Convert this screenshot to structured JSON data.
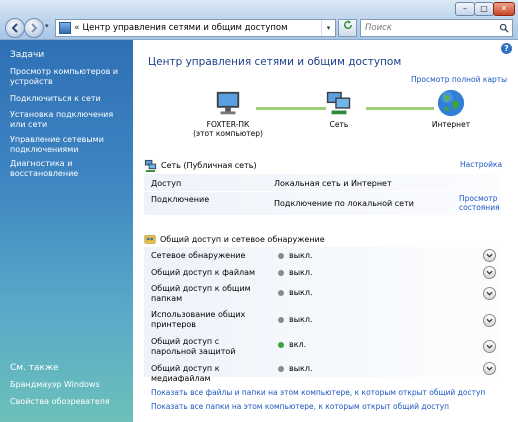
{
  "window": {
    "address_path": "Центр управления сетями и общим доступом",
    "address_prefix": "«",
    "search_placeholder": "Поиск",
    "min_label": "–",
    "max_label": "□",
    "close_label": "✕"
  },
  "sidebar": {
    "tasks_heading": "Задачи",
    "items": [
      "Просмотр компьютеров и устройств",
      "Подключиться к сети",
      "Установка подключения или сети",
      "Управление сетевыми подключениями",
      "Диагностика и восстановление"
    ],
    "see_also_heading": "См. также",
    "see_also": [
      "Брандмауэр Windows",
      "Свойства обозревателя"
    ]
  },
  "main": {
    "title": "Центр управления сетями и общим доступом",
    "full_map_link": "Просмотр полной карты",
    "map": {
      "computer": "FOXTER-ПК",
      "computer_sub": "(этот компьютер)",
      "network": "Сеть",
      "internet": "Интернет"
    },
    "network_section": {
      "title": "Сеть (Публичная сеть)",
      "settings_link": "Настройка",
      "rows": [
        {
          "label": "Доступ",
          "value": "Локальная сеть и Интернет"
        },
        {
          "label": "Подключение",
          "value": "Подключение по локальной сети"
        }
      ],
      "status_link_1": "Просмотр",
      "status_link_2": "состояния"
    },
    "sharing_section": {
      "title": "Общий доступ и сетевое обнаружение",
      "rows": [
        {
          "label": "Сетевое обнаружение",
          "state": "выкл."
        },
        {
          "label": "Общий доступ к файлам",
          "state": "выкл."
        },
        {
          "label": "Общий доступ к общим папкам",
          "state": "выкл."
        },
        {
          "label": "Использование общих принтеров",
          "state": "выкл."
        },
        {
          "label": "Общий доступ с парольной защитой",
          "state": "вкл."
        },
        {
          "label": "Общий доступ к медиафайлам",
          "state": "выкл."
        }
      ]
    },
    "bottom_links": [
      "Показать все файлы и папки на этом компьютере, к которым открыт общий доступ",
      "Показать все папки на этом компьютере, к которым открыт общий доступ"
    ]
  },
  "colors": {
    "state_off": "#8a8a8a",
    "state_on": "#3aa53a",
    "link": "#1d57c2",
    "title": "#1e3f8a"
  }
}
